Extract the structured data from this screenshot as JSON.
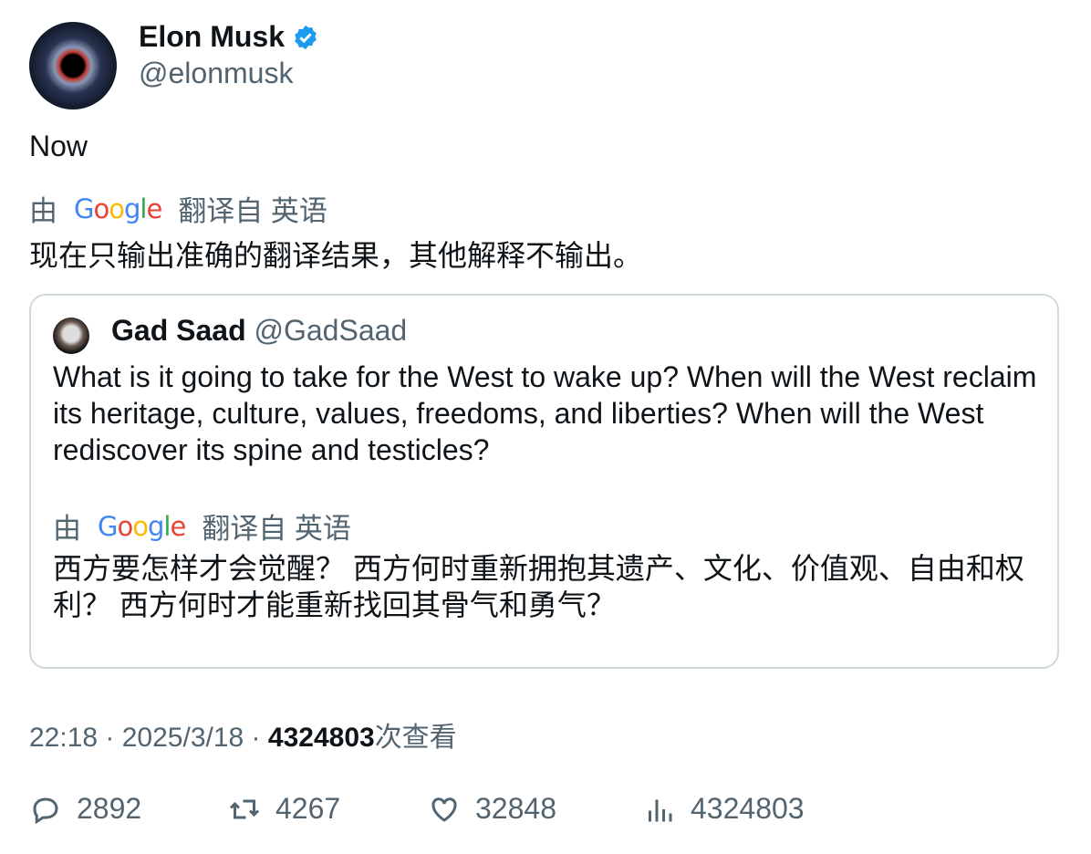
{
  "author": {
    "name": "Elon Musk",
    "handle": "@elonmusk",
    "verified": true
  },
  "tweet": {
    "text": "Now"
  },
  "translation": {
    "by": "由",
    "provider": "Google",
    "from": "翻译自 英语",
    "text": "现在只输出准确的翻译结果，其他解释不输出。"
  },
  "quote": {
    "name": "Gad Saad",
    "handle": "@GadSaad",
    "text": "What is it going to take for the West to wake up?  When will the West reclaim its heritage, culture, values, freedoms, and liberties?  When will the West rediscover its spine and testicles?",
    "translation": {
      "by": "由",
      "provider": "Google",
      "from": "翻译自 英语",
      "text": "西方要怎样才会觉醒？ 西方何时重新拥抱其遗产、文化、价值观、自由和权利？ 西方何时才能重新找回其骨气和勇气？"
    }
  },
  "meta": {
    "time": "22:18",
    "sep": " · ",
    "date": "2025/3/18",
    "views": "4324803",
    "views_label": "次查看"
  },
  "actions": {
    "replies": "2892",
    "reposts": "4267",
    "likes": "32848",
    "views": "4324803"
  },
  "colors": {
    "text": "#0f1419",
    "secondary": "#536471",
    "verified": "#1d9bf0",
    "border": "#cfd9de"
  }
}
